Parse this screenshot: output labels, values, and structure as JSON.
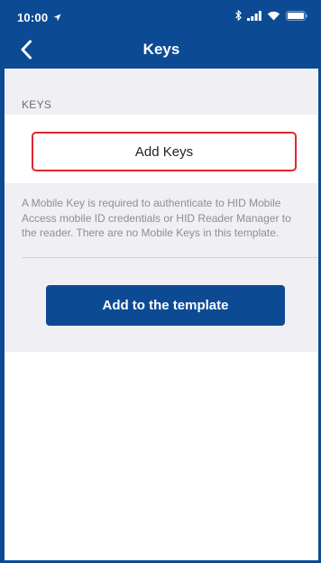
{
  "status_bar": {
    "time": "10:00",
    "location_icon": "location-arrow-icon",
    "bluetooth_icon": "bluetooth-icon",
    "signal_icon": "cellular-signal-icon",
    "wifi_icon": "wifi-icon",
    "battery_icon": "battery-icon"
  },
  "nav": {
    "title": "Keys",
    "back_icon": "chevron-left-icon"
  },
  "keys_section": {
    "header": "KEYS",
    "add_keys_label": "Add Keys",
    "footer": "A Mobile Key is required to authenticate to HID Mobile Access mobile ID credentials or HID Reader Manager to the reader. There are no Mobile Keys in this template."
  },
  "actions": {
    "add_to_template_label": "Add to the template"
  },
  "colors": {
    "brand": "#0d4a94",
    "highlight": "#e0262e",
    "background": "#efeff4"
  }
}
